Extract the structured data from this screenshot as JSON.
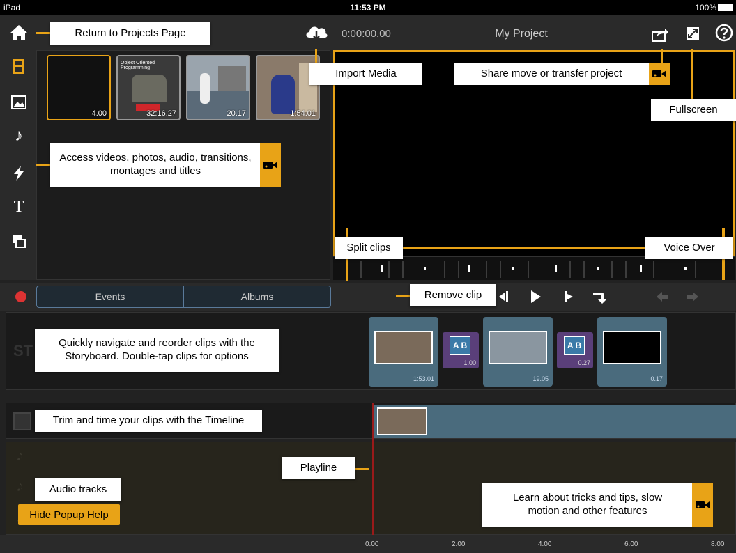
{
  "status": {
    "device": "iPad",
    "time": "11:53 PM",
    "battery": "100%"
  },
  "header": {
    "timecode": "0:00:00.00",
    "project_title": "My Project"
  },
  "media": {
    "thumbs": [
      {
        "duration": "4.00",
        "caption": ""
      },
      {
        "duration": "32:16.27",
        "caption": "Object Oriented Programming"
      },
      {
        "duration": "20.17",
        "caption": ""
      },
      {
        "duration": "1:54.01",
        "caption": ""
      }
    ]
  },
  "segments": {
    "events": "Events",
    "albums": "Albums"
  },
  "storyboard": {
    "label": "ST",
    "clips": [
      {
        "duration": "1:53.01"
      },
      {
        "duration": "19.05"
      },
      {
        "duration": "0.17"
      }
    ],
    "transitions": [
      {
        "a": "A",
        "b": "B",
        "duration": "1.00"
      },
      {
        "a": "A",
        "b": "B",
        "duration": "0.27"
      }
    ]
  },
  "ruler": {
    "ticks": [
      "0.00",
      "2.00",
      "4.00",
      "6.00",
      "8.00"
    ]
  },
  "callouts": {
    "return_projects": "Return to Projects Page",
    "import_media": "Import Media",
    "share": "Share move or transfer project",
    "fullscreen": "Fullscreen",
    "access_media": "Access videos, photos, audio, transitions, montages and titles",
    "split_clips": "Split clips",
    "voice_over": "Voice Over",
    "remove_clip": "Remove clip",
    "storyboard": "Quickly navigate and reorder clips with the Storyboard. Double-tap clips for options",
    "timeline": "Trim and time your clips with the Timeline",
    "playline": "Playline",
    "audio_tracks": "Audio tracks",
    "tricks": "Learn about tricks and tips, slow motion and other features"
  },
  "hide_help": "Hide Popup Help",
  "colors": {
    "accent": "#e8a317",
    "record": "#dd3333",
    "clip": "#4a6b7d",
    "transition": "#5a3f7a"
  }
}
